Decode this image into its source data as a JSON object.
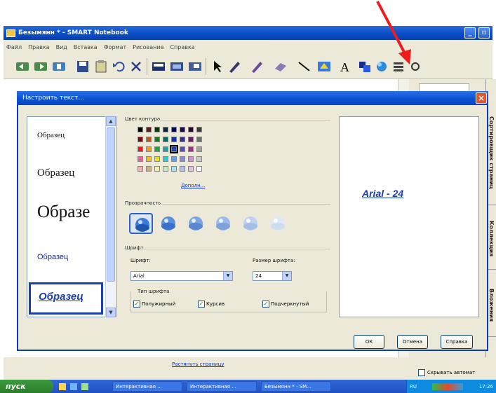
{
  "window": {
    "title": "Безымянн * - SMART Notebook"
  },
  "menu": [
    "Файл",
    "Правка",
    "Вид",
    "Вставка",
    "Формат",
    "Рисование",
    "Справка"
  ],
  "toolbar": {
    "icons": [
      "back-icon",
      "forward-icon",
      "add-page-icon",
      "save-icon",
      "paste-icon",
      "undo-icon",
      "delete-icon",
      "screen-shade-icon",
      "full-screen-icon",
      "capture-icon",
      "select-arrow-icon",
      "pen-icon",
      "creative-pen-icon",
      "eraser-icon",
      "line-icon",
      "fill-icon",
      "text-tool-icon",
      "shapes-icon",
      "gallery-icon",
      "properties-icon",
      "more-icon"
    ]
  },
  "dialog": {
    "title": "Настроить текст...",
    "samples": [
      "Образец",
      "Образец",
      "Образе",
      "Образец",
      "Образец"
    ],
    "contour_color_label": "Цвет контура",
    "more_colors": "Дополн...",
    "transparency_label": "Прозрачность",
    "font_group_label": "Шрифт",
    "font_label": "Шрифт:",
    "font_value": "Arial",
    "size_label": "Размер шрифта:",
    "size_value": "24",
    "font_type_label": "Тип шрифта",
    "bold_label": "Полужирный",
    "italic_label": "Курсив",
    "underline_label": "Подчеркнутый",
    "preview_text": "Arial - 24",
    "ok": "ОК",
    "cancel": "Отмена",
    "help": "Справка",
    "selected_color": "#1e3fb8"
  },
  "canvas": {
    "stretch_link": "Растянуть страницу"
  },
  "side_tabs": [
    "Сортировщик страниц",
    "Коллекция",
    "Вложения"
  ],
  "hide_auto": "Скрывать автомат",
  "taskbar": {
    "start": "пуск",
    "tasks": [
      "Интерактивная ...",
      "Интерактивная ...",
      "Безымянн * - SM..."
    ],
    "lang": "RU",
    "time": "17:26"
  },
  "annotation": {
    "arrow_color": "#ee1c1c"
  }
}
